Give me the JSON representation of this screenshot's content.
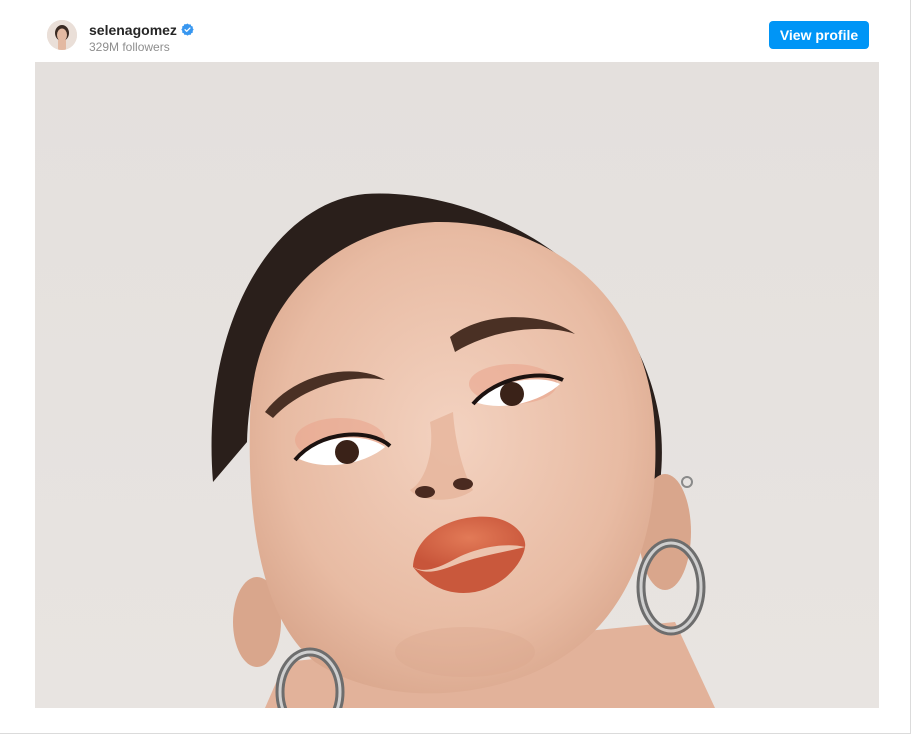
{
  "post": {
    "username": "selenagomez",
    "verified": true,
    "followers": "329M followers",
    "view_profile_label": "View profile"
  },
  "colors": {
    "accent": "#0095f6",
    "verified_badge": "#3897f0",
    "username": "#262626",
    "secondary_text": "#8e8e8e",
    "photo_background": "#e6e2df"
  },
  "icons": {
    "verified": "verified-badge-icon"
  }
}
